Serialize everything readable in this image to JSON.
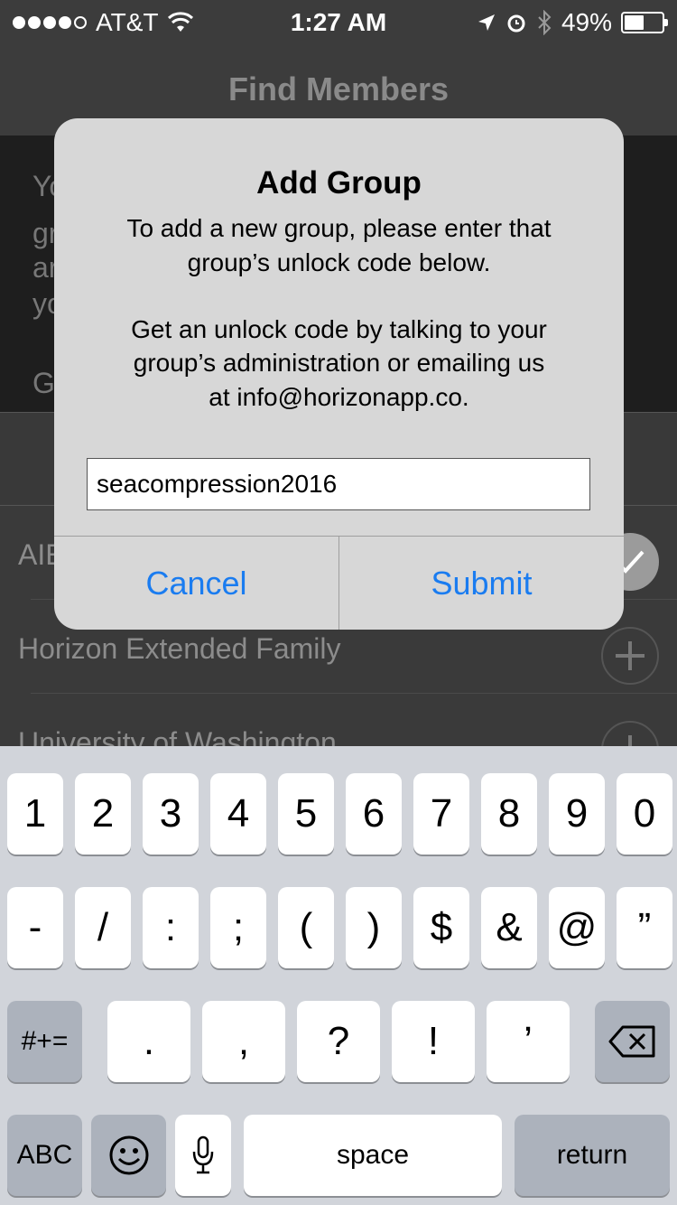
{
  "status_bar": {
    "carrier": "AT&T",
    "time": "1:27 AM",
    "battery": "49%",
    "signal_bars_filled": 4,
    "signal_bars_total": 5,
    "battery_level": 0.49
  },
  "nav": {
    "title": "Find Members"
  },
  "background_panel": {
    "text_fragments": [
      "Yo",
      "gr",
      "ar",
      "yo",
      "G"
    ]
  },
  "groups": [
    {
      "name": "AIE",
      "state": "joined"
    },
    {
      "name": "Horizon Extended Family",
      "state": "add"
    },
    {
      "name": "University of Washington",
      "state": "add"
    }
  ],
  "alert": {
    "title": "Add Group",
    "message_1a": "To add a new group, please enter that",
    "message_1b": "group’s unlock code below.",
    "message_2a": "Get an unlock code by talking to your",
    "message_2b": "group’s administration or emailing us",
    "message_2c": "at info@horizonapp.co.",
    "input_value": "seacompression2016",
    "cancel_label": "Cancel",
    "submit_label": "Submit"
  },
  "keyboard": {
    "row1": [
      "1",
      "2",
      "3",
      "4",
      "5",
      "6",
      "7",
      "8",
      "9",
      "0"
    ],
    "row2": [
      "-",
      "/",
      ":",
      ";",
      "(",
      ")",
      "$",
      "&",
      "@",
      "”"
    ],
    "row3_shift": "#+=",
    "row3": [
      ".",
      ",",
      "?",
      "!",
      "’"
    ],
    "abc": "ABC",
    "space": "space",
    "return": "return"
  },
  "colors": {
    "accent": "#1a7cf0",
    "alert_bg": "#d7d7d7",
    "keyboard_bg": "#d1d4da"
  }
}
